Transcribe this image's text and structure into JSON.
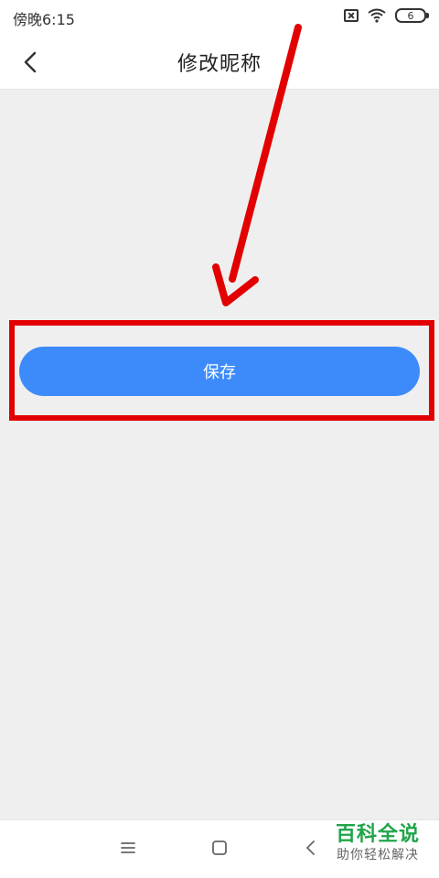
{
  "status_bar": {
    "time": "傍晚6:15",
    "battery": "6",
    "icons": [
      "notification-x-icon",
      "wifi-icon",
      "battery-icon"
    ]
  },
  "header": {
    "title": "修改昵称",
    "back_icon": "chevron-left-icon"
  },
  "main": {
    "save_button_label": "保存"
  },
  "annotation": {
    "arrow_color": "#e20000",
    "highlight_color": "#e20000"
  },
  "nav_bar": {
    "items": [
      {
        "icon": "menu-icon"
      },
      {
        "icon": "home-square-icon"
      },
      {
        "icon": "back-chevron-icon"
      }
    ]
  },
  "watermark": {
    "title": "百科全说",
    "subtitle": "助你轻松解决"
  },
  "colors": {
    "accent": "#3d8bfa",
    "background": "#efefef",
    "watermark_green": "#1fa54a"
  }
}
